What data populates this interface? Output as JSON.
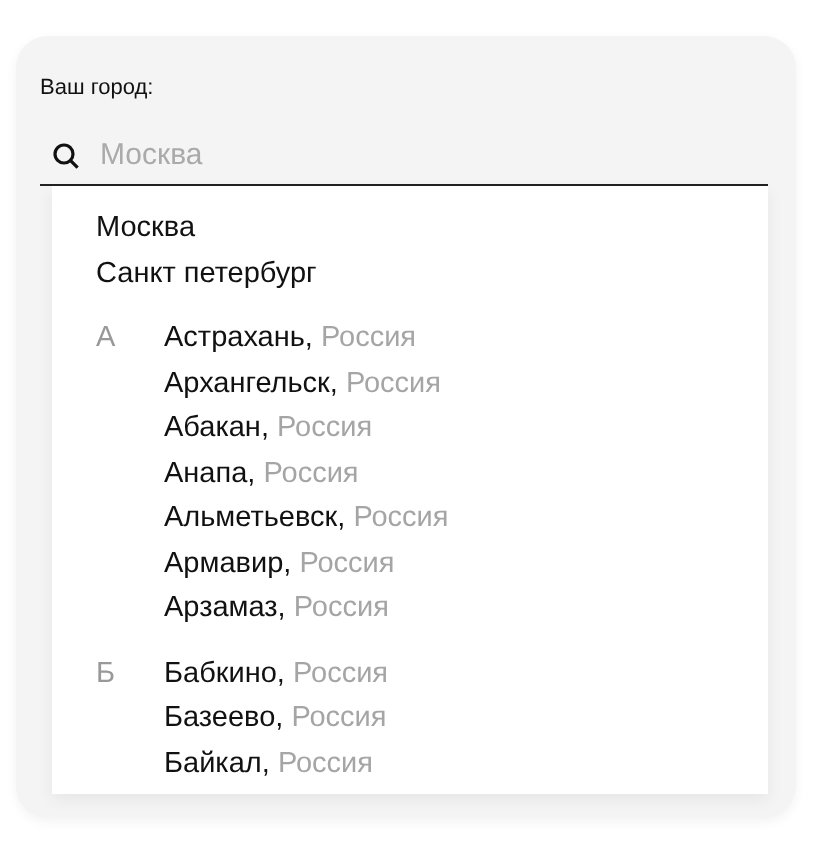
{
  "label": "Ваш город:",
  "search": {
    "placeholder": "Москва"
  },
  "popular": [
    "Москва",
    "Санкт петербург"
  ],
  "groups": [
    {
      "letter": "А",
      "cities": [
        {
          "name": "Астрахань,",
          "country": "Россия"
        },
        {
          "name": "Архангельск,",
          "country": "Россия"
        },
        {
          "name": "Абакан,",
          "country": "Россия"
        },
        {
          "name": "Анапа,",
          "country": "Россия"
        },
        {
          "name": "Альметьевск,",
          "country": "Россия"
        },
        {
          "name": "Армавир,",
          "country": "Россия"
        },
        {
          "name": "Арзамаз,",
          "country": "Россия"
        }
      ]
    },
    {
      "letter": "Б",
      "cities": [
        {
          "name": "Бабкино,",
          "country": "Россия"
        },
        {
          "name": "Базеево,",
          "country": "Россия"
        },
        {
          "name": "Байкал,",
          "country": "Россия"
        }
      ]
    }
  ]
}
